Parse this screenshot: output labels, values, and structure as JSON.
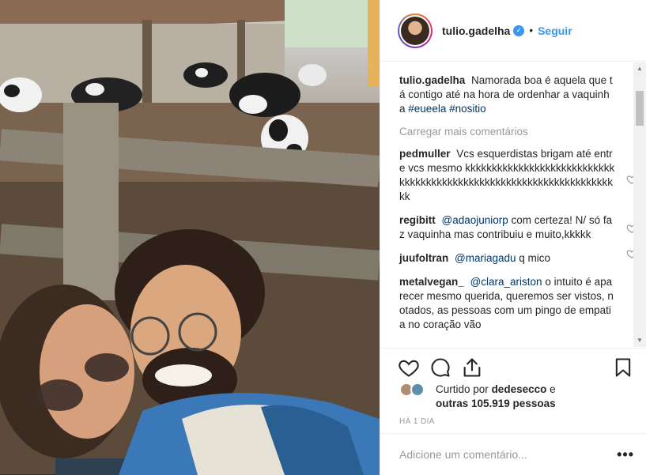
{
  "post": {
    "username": "tulio.gadelha",
    "verified_mark": "✓",
    "separator": "•",
    "follow_label": "Seguir"
  },
  "caption": {
    "author": "tulio.gadelha",
    "text": "Namorada boa é aquela que tá contigo até na hora de ordenhar a vaquinha",
    "hashtag1": "#eueela",
    "hashtag2": "#nositio"
  },
  "load_more_label": "Carregar mais comentários",
  "comments": [
    {
      "author": "pedmuller",
      "text": "Vcs esquerdistas brigam até entre vcs mesmo kkkkkkkkkkkkkkkkkkkkkkkkkkkkkkkkkkkkkkkkkkkkkkkkkkkkkkkkkkkkkkkkkkkkkk"
    },
    {
      "author": "regibitt",
      "mention": "@adaojuniorp",
      "text": "com certeza! N/ só faz vaquinha mas contribuiu e muito,kkkkk"
    },
    {
      "author": "juufoltran",
      "mention": "@mariagadu",
      "text": "q mico"
    },
    {
      "author": "metalvegan_",
      "mention": "@clara_ariston",
      "text": "o intuito é aparecer mesmo querida, queremos ser vistos, notados, as pessoas com um pingo de empatia no coração vão"
    }
  ],
  "likes": {
    "prefix": "Curtido por",
    "user": "dedesecco",
    "connector": "e",
    "others": "outras 105.919 pessoas"
  },
  "timestamp": "HÁ 1 DIA",
  "add_comment_placeholder": "Adicione um comentário...",
  "more_options": "•••",
  "icons": {
    "like": "heart-icon",
    "comment": "comment-icon",
    "share": "share-icon",
    "save": "bookmark-icon"
  },
  "colors": {
    "link": "#003569",
    "follow": "#3897f0",
    "muted": "#999999"
  }
}
